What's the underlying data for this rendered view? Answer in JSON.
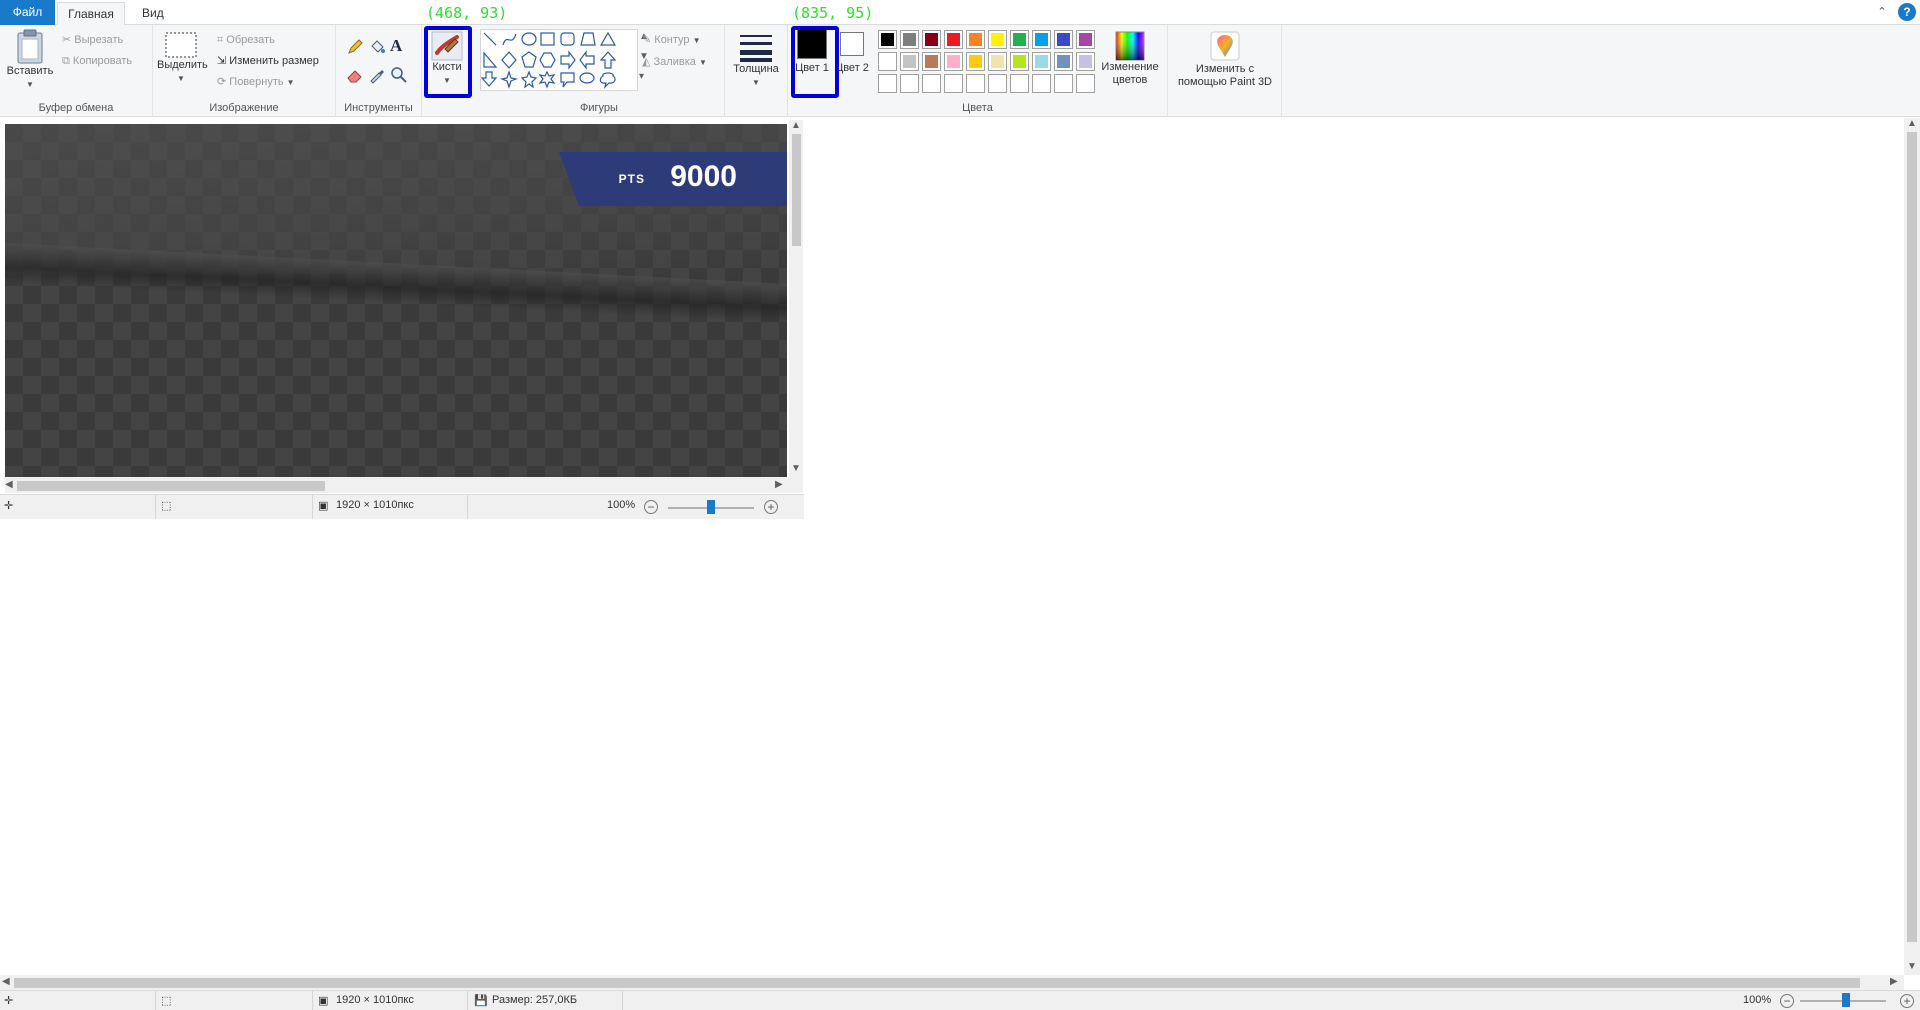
{
  "menu": {
    "file": "Файл",
    "home": "Главная",
    "view": "Вид",
    "help": "?"
  },
  "clipboard": {
    "paste": "Вставить",
    "cut": "Вырезать",
    "copy": "Копировать",
    "label": "Буфер обмена"
  },
  "image": {
    "select": "Выделить",
    "crop": "Обрезать",
    "resize": "Изменить размер",
    "rotate": "Повернуть",
    "label": "Изображение"
  },
  "tools": {
    "label": "Инструменты",
    "text_glyph": "A"
  },
  "brushes": {
    "label": "Кисти"
  },
  "shapes": {
    "label": "Фигуры",
    "outline": "Контур",
    "fill": "Заливка"
  },
  "size": {
    "label": "Толщина"
  },
  "colors": {
    "color1": "Цвет 1",
    "color2": "Цвет 2",
    "edit": "Изменение цветов",
    "label": "Цвета",
    "palette_row1": [
      "#000000",
      "#7f7f7f",
      "#880015",
      "#ed1c24",
      "#ff7f27",
      "#fff200",
      "#22b14c",
      "#00a2e8",
      "#3f48cc",
      "#a349a4"
    ],
    "palette_row2": [
      "#ffffff",
      "#c3c3c3",
      "#b97a57",
      "#ffaec9",
      "#ffc90e",
      "#efe4b0",
      "#b5e61d",
      "#99d9ea",
      "#7092be",
      "#c8bfe7"
    ],
    "palette_row3": [
      "#ffffff",
      "#ffffff",
      "#ffffff",
      "#ffffff",
      "#ffffff",
      "#ffffff",
      "#ffffff",
      "#ffffff",
      "#ffffff",
      "#ffffff"
    ]
  },
  "paint3d": {
    "label": "Изменить с помощью Paint 3D"
  },
  "annotations": {
    "brushes_coord": "(468, 93)",
    "color1_coord": "(835, 95)"
  },
  "canvas": {
    "pts_label": "PTS",
    "pts_value": "9000"
  },
  "inner_status": {
    "dimensions": "1920 × 1010пкс",
    "zoom": "100%"
  },
  "status": {
    "dimensions": "1920 × 1010пкс",
    "filesize": "Размер: 257,0КБ",
    "zoom": "100%"
  }
}
